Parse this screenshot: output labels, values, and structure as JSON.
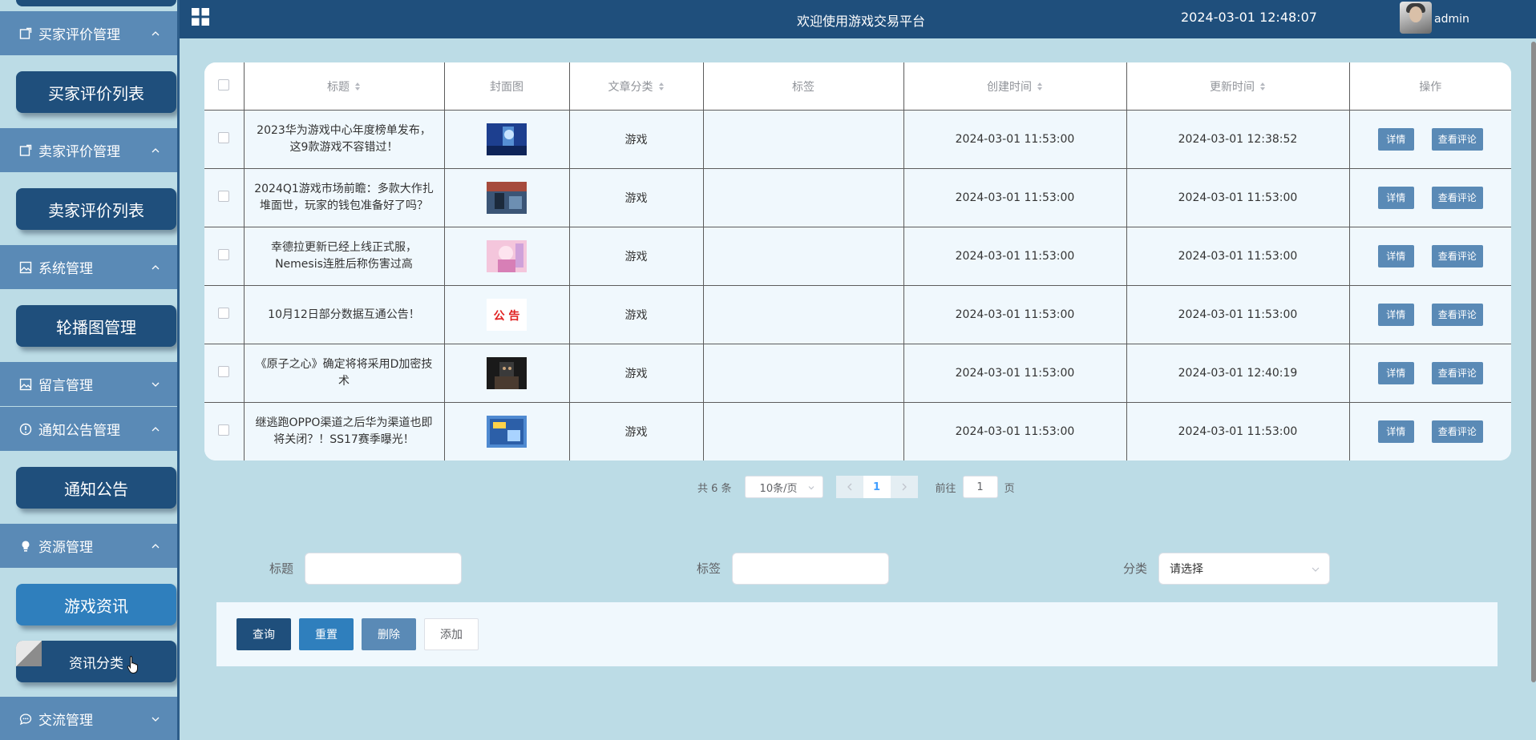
{
  "header": {
    "title": "欢迎使用游戏交易平台",
    "datetime": "2024-03-01 12:48:07",
    "username": "admin"
  },
  "sidebar": {
    "groups": [
      {
        "label": "买家评价管理",
        "icon": "square-edit-icon",
        "chevron": "up"
      },
      {
        "label": "卖家评价管理",
        "icon": "square-edit-icon",
        "chevron": "up"
      },
      {
        "label": "系统管理",
        "icon": "image-icon",
        "chevron": "up"
      },
      {
        "label": "留言管理",
        "icon": "image-icon",
        "chevron": "down"
      },
      {
        "label": "通知公告管理",
        "icon": "info-circle-icon",
        "chevron": "up"
      },
      {
        "label": "资源管理",
        "icon": "lightbulb-icon",
        "chevron": "up"
      },
      {
        "label": "交流管理",
        "icon": "chat-icon",
        "chevron": "down"
      }
    ],
    "subitems": [
      {
        "label": "买家评价列表"
      },
      {
        "label": "卖家评价列表"
      },
      {
        "label": "轮播图管理"
      },
      {
        "label": "通知公告"
      },
      {
        "label": "游戏资讯",
        "active": true
      },
      {
        "label": "资讯分类",
        "hovered": true
      }
    ]
  },
  "table": {
    "columns": [
      "",
      "标题",
      "封面图",
      "文章分类",
      "标签",
      "创建时间",
      "更新时间",
      "操作"
    ],
    "rows": [
      {
        "title": "2023华为游戏中心年度榜单发布，这9款游戏不容错过！",
        "category": "游戏",
        "tag": "",
        "created": "2024-03-01 11:53:00",
        "updated": "2024-03-01 12:38:52",
        "cover": "blue-hero"
      },
      {
        "title": "2024Q1游戏市场前瞻：多款大作扎堆面世，玩家的钱包准备好了吗？",
        "category": "游戏",
        "tag": "",
        "created": "2024-03-01 11:53:00",
        "updated": "2024-03-01 11:53:00",
        "cover": "battle"
      },
      {
        "title": "幸德拉更新已经上线正式服，Nemesis连胜后称伤害过高",
        "category": "游戏",
        "tag": "",
        "created": "2024-03-01 11:53:00",
        "updated": "2024-03-01 11:53:00",
        "cover": "pink-anime"
      },
      {
        "title": "10月12日部分数据互通公告！",
        "category": "游戏",
        "tag": "",
        "created": "2024-03-01 11:53:00",
        "updated": "2024-03-01 11:53:00",
        "cover": "notice"
      },
      {
        "title": "《原子之心》确定将将采用D加密技术",
        "category": "游戏",
        "tag": "",
        "created": "2024-03-01 11:53:00",
        "updated": "2024-03-01 12:40:19",
        "cover": "dark-robot"
      },
      {
        "title": "继逃跑OPPO渠道之后华为渠道也即将关闭？！SS17赛季曝光！",
        "category": "游戏",
        "tag": "",
        "created": "2024-03-01 11:53:00",
        "updated": "2024-03-01 11:53:00",
        "cover": "blue-poster"
      }
    ],
    "detail_label": "详情",
    "comment_label": "查看评论",
    "cover_notice_text": "公 告"
  },
  "pagination": {
    "total": "共 6 条",
    "page_size": "10条/页",
    "current_page": "1",
    "goto_label": "前往",
    "goto_value": "1",
    "page_suffix": "页"
  },
  "search": {
    "title_label": "标题",
    "tag_label": "标签",
    "category_label": "分类",
    "category_placeholder": "请选择"
  },
  "actions": {
    "query": "查询",
    "reset": "重置",
    "delete": "删除",
    "add": "添加"
  },
  "colors": {
    "header_bg": "#1f4f7c",
    "page_bg": "#bcdce6",
    "group_bg": "#5a8ab6",
    "active_sub_bg": "#2f7fbd",
    "row_bg": "#f0f8fd"
  }
}
